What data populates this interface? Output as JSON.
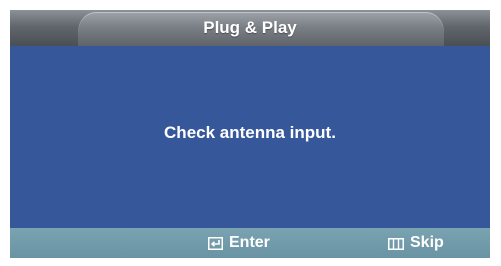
{
  "window": {
    "title": "Plug & Play"
  },
  "main": {
    "message": "Check antenna input."
  },
  "footer": {
    "enter": {
      "icon": "enter-icon",
      "label": "Enter"
    },
    "skip": {
      "icon": "menu-icon",
      "label": "Skip"
    }
  },
  "colors": {
    "panel": "#36579a",
    "footer": "#6a93a3",
    "header": "#62676d",
    "text": "#ffffff"
  }
}
